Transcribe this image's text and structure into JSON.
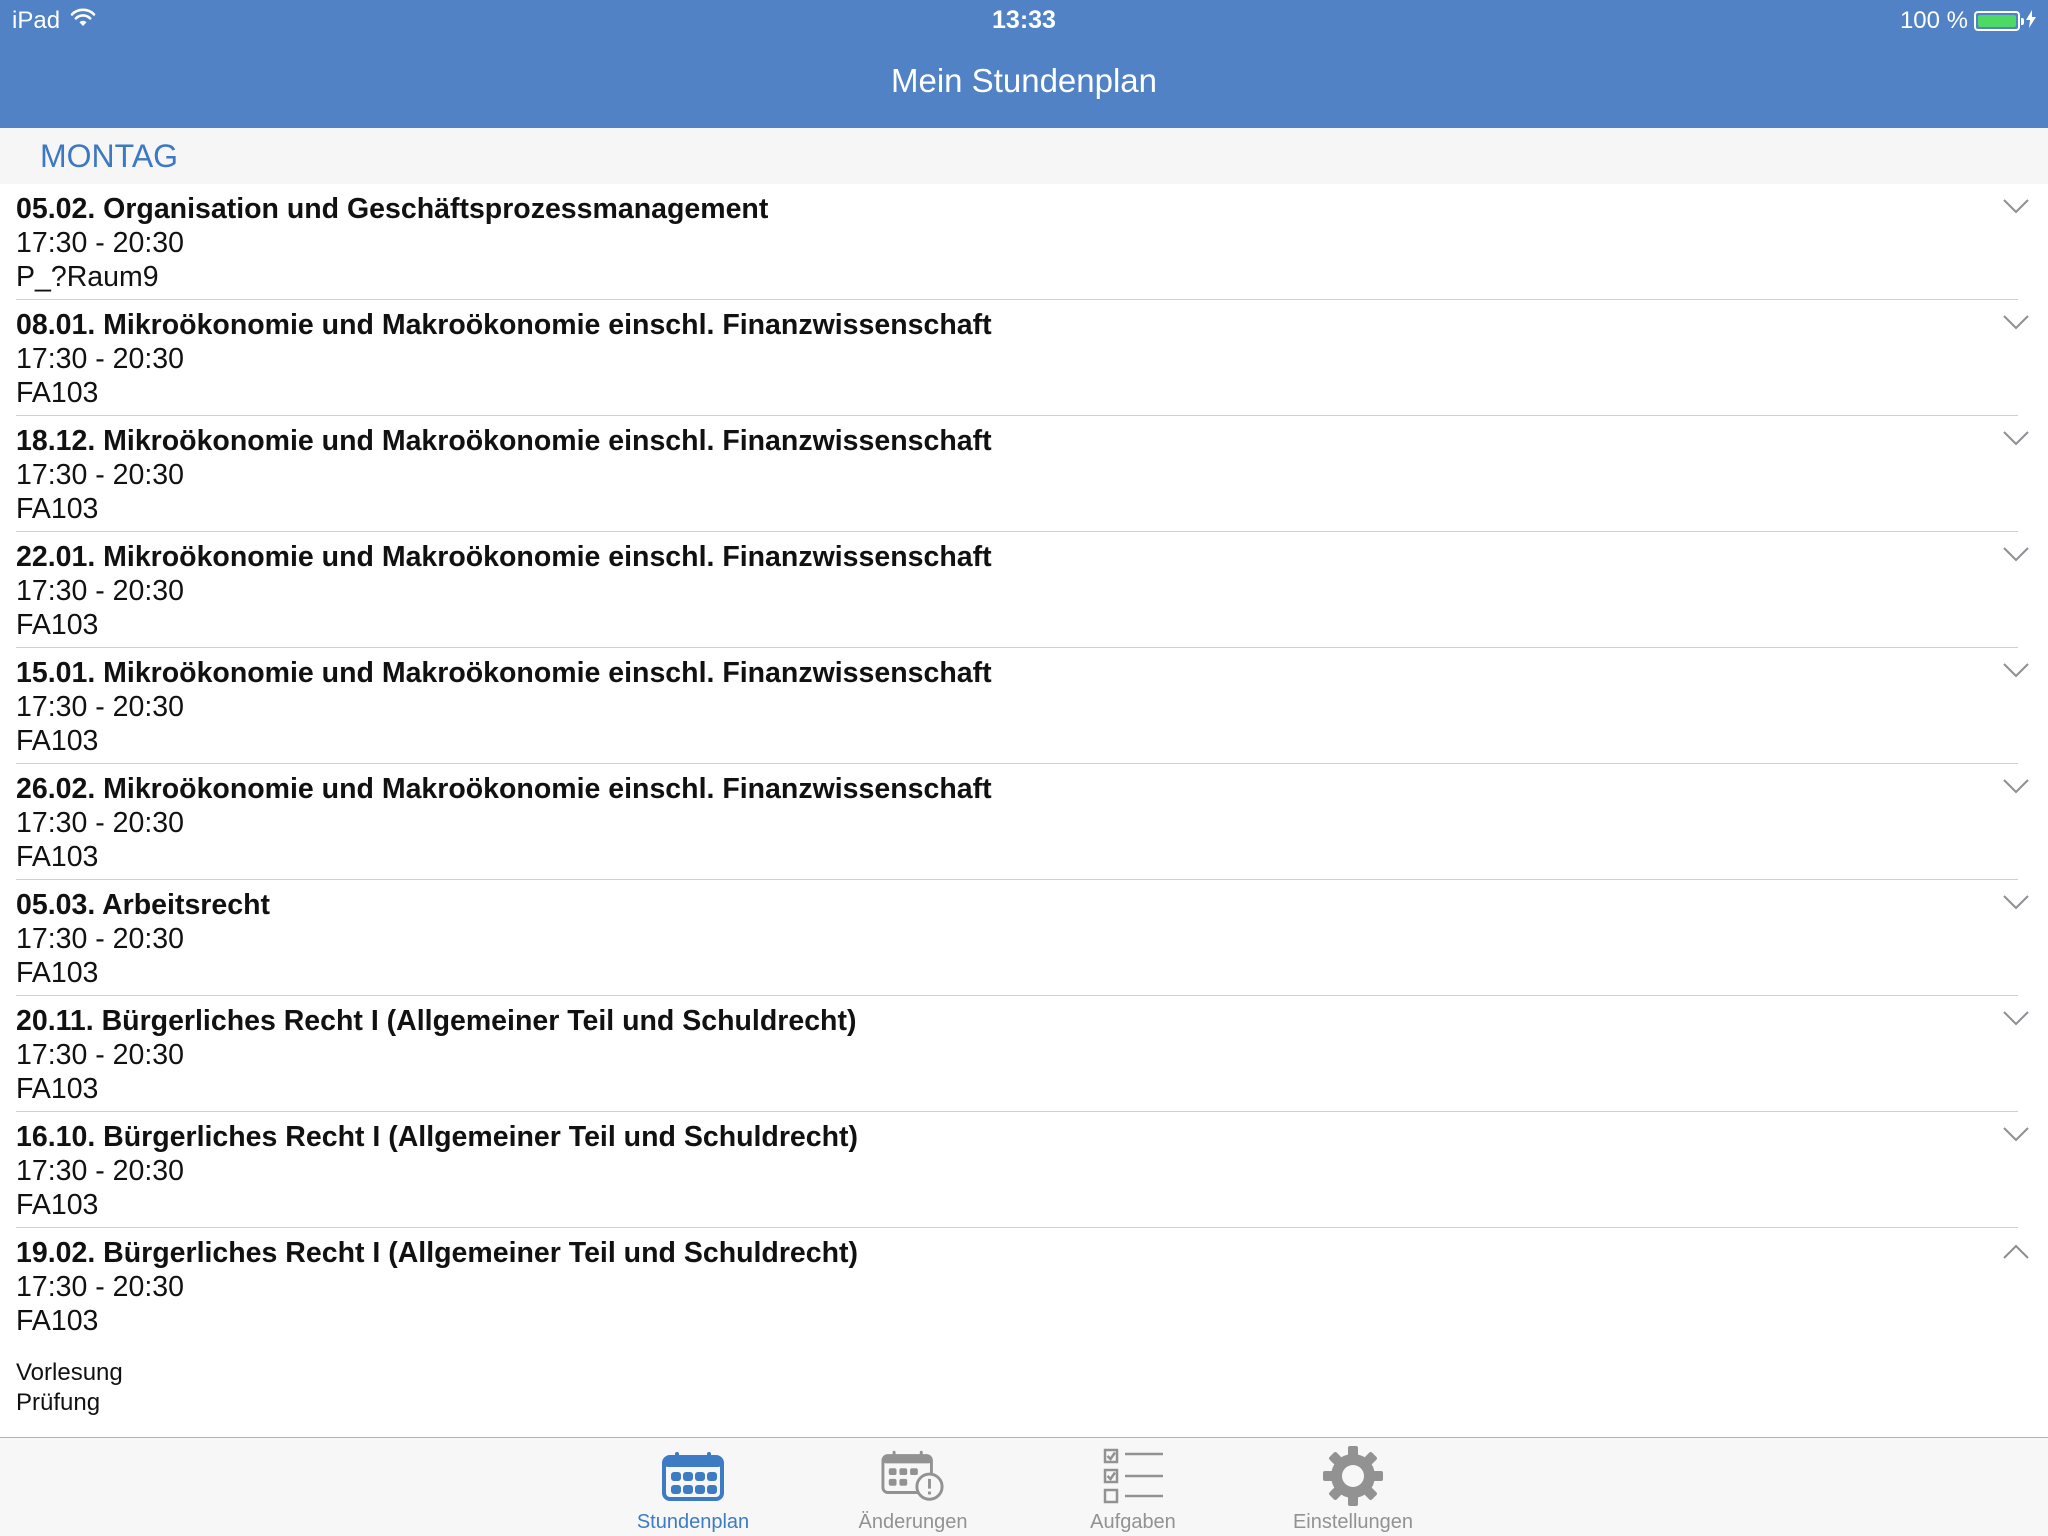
{
  "status_bar": {
    "device": "iPad",
    "time": "13:33",
    "battery": "100 %",
    "icons": [
      "wifi-icon",
      "battery-icon",
      "charging-bolt-icon"
    ]
  },
  "nav": {
    "title": "Mein Stundenplan"
  },
  "section": {
    "title": "MONTAG"
  },
  "items": [
    {
      "title": "05.02. Organisation und Geschäftsprozessmanagement",
      "time": "17:30 - 20:30",
      "room": "P_?Raum9",
      "expanded": false
    },
    {
      "title": "08.01. Mikroökonomie und Makroökonomie einschl. Finanzwissenschaft",
      "time": "17:30 - 20:30",
      "room": "FA103",
      "expanded": false
    },
    {
      "title": "18.12. Mikroökonomie und Makroökonomie einschl. Finanzwissenschaft",
      "time": "17:30 - 20:30",
      "room": "FA103",
      "expanded": false
    },
    {
      "title": "22.01. Mikroökonomie und Makroökonomie einschl. Finanzwissenschaft",
      "time": "17:30 - 20:30",
      "room": "FA103",
      "expanded": false
    },
    {
      "title": "15.01. Mikroökonomie und Makroökonomie einschl. Finanzwissenschaft",
      "time": "17:30 - 20:30",
      "room": "FA103",
      "expanded": false
    },
    {
      "title": "26.02. Mikroökonomie und Makroökonomie einschl. Finanzwissenschaft",
      "time": "17:30 - 20:30",
      "room": "FA103",
      "expanded": false
    },
    {
      "title": "05.03. Arbeitsrecht",
      "time": "17:30 - 20:30",
      "room": "FA103",
      "expanded": false
    },
    {
      "title": "20.11. Bürgerliches Recht I (Allgemeiner Teil und Schuldrecht)",
      "time": "17:30 - 20:30",
      "room": "FA103",
      "expanded": false
    },
    {
      "title": "16.10. Bürgerliches Recht I (Allgemeiner Teil und Schuldrecht)",
      "time": "17:30 - 20:30",
      "room": "FA103",
      "expanded": false
    },
    {
      "title": "19.02. Bürgerliches Recht I (Allgemeiner Teil und Schuldrecht)",
      "time": "17:30 - 20:30",
      "room": "FA103",
      "expanded": true,
      "details": [
        "Vorlesung",
        "Prüfung"
      ]
    }
  ],
  "tabs": [
    {
      "label": "Stundenplan",
      "icon": "calendar-icon",
      "active": true
    },
    {
      "label": "Änderungen",
      "icon": "calendar-alert-icon",
      "active": false
    },
    {
      "label": "Aufgaben",
      "icon": "checklist-icon",
      "active": false
    },
    {
      "label": "Einstellungen",
      "icon": "gear-icon",
      "active": false
    }
  ],
  "colors": {
    "header_blue": "#5082c5",
    "section_blue": "#3c78c3",
    "tab_active": "#3d7bc4",
    "tab_inactive": "#929292",
    "battery_green": "#4cd964"
  }
}
